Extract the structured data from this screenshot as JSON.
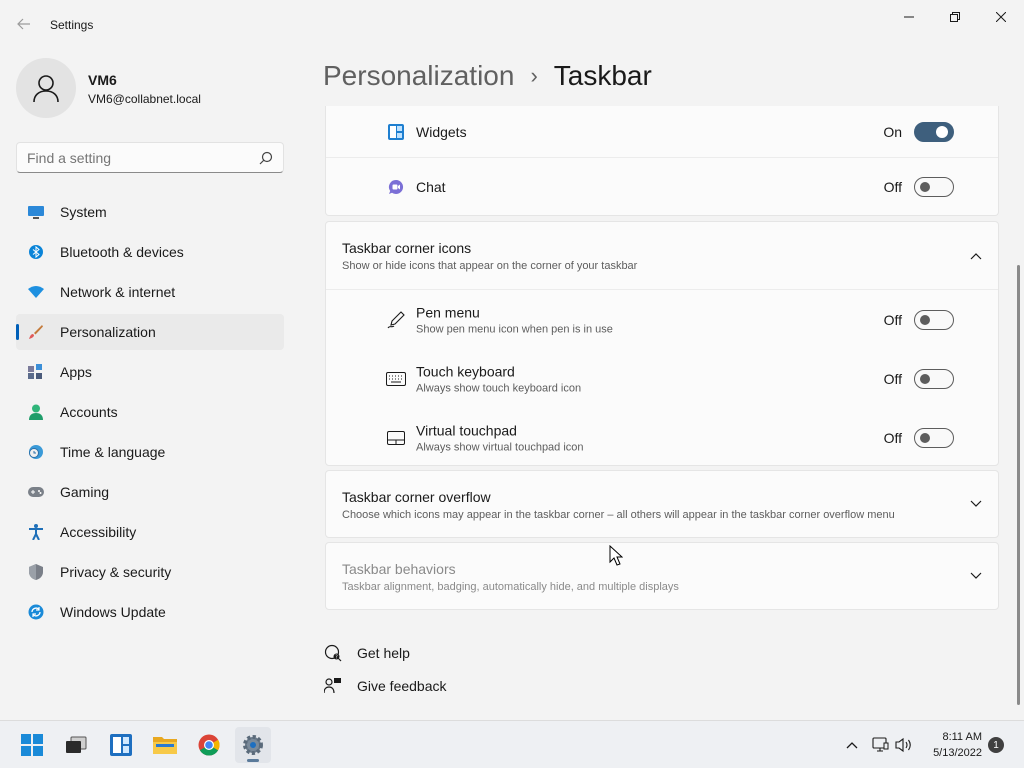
{
  "window": {
    "title": "Settings"
  },
  "user": {
    "name": "VM6",
    "email": "VM6@collabnet.local"
  },
  "search": {
    "placeholder": "Find a setting"
  },
  "sidebar": {
    "items": [
      {
        "label": "System",
        "icon": "monitor-icon"
      },
      {
        "label": "Bluetooth & devices",
        "icon": "bluetooth-icon"
      },
      {
        "label": "Network & internet",
        "icon": "wifi-icon"
      },
      {
        "label": "Personalization",
        "icon": "brush-icon",
        "active": true
      },
      {
        "label": "Apps",
        "icon": "apps-icon"
      },
      {
        "label": "Accounts",
        "icon": "person-icon"
      },
      {
        "label": "Time & language",
        "icon": "clock-globe-icon"
      },
      {
        "label": "Gaming",
        "icon": "gamepad-icon"
      },
      {
        "label": "Accessibility",
        "icon": "accessibility-icon"
      },
      {
        "label": "Privacy & security",
        "icon": "shield-icon"
      },
      {
        "label": "Windows Update",
        "icon": "update-icon"
      }
    ]
  },
  "breadcrumb": {
    "parent": "Personalization",
    "separator": "›",
    "current": "Taskbar"
  },
  "taskbar_items": {
    "widgets": {
      "label": "Widgets",
      "state": "On",
      "on": true
    },
    "chat": {
      "label": "Chat",
      "state": "Off",
      "on": false
    }
  },
  "corner_icons": {
    "title": "Taskbar corner icons",
    "subtitle": "Show or hide icons that appear on the corner of your taskbar",
    "items": [
      {
        "label": "Pen menu",
        "sub": "Show pen menu icon when pen is in use",
        "state": "Off"
      },
      {
        "label": "Touch keyboard",
        "sub": "Always show touch keyboard icon",
        "state": "Off"
      },
      {
        "label": "Virtual touchpad",
        "sub": "Always show virtual touchpad icon",
        "state": "Off"
      }
    ]
  },
  "corner_overflow": {
    "title": "Taskbar corner overflow",
    "subtitle": "Choose which icons may appear in the taskbar corner – all others will appear in the taskbar corner overflow menu"
  },
  "behaviors": {
    "title": "Taskbar behaviors",
    "subtitle": "Taskbar alignment, badging, automatically hide, and multiple displays"
  },
  "help": {
    "get_help": "Get help",
    "feedback": "Give feedback"
  },
  "tray": {
    "time": "8:11 AM",
    "date": "5/13/2022",
    "notifications": "1"
  },
  "colors": {
    "accent": "#005fb8",
    "toggle_on": "#3e5f7d"
  }
}
